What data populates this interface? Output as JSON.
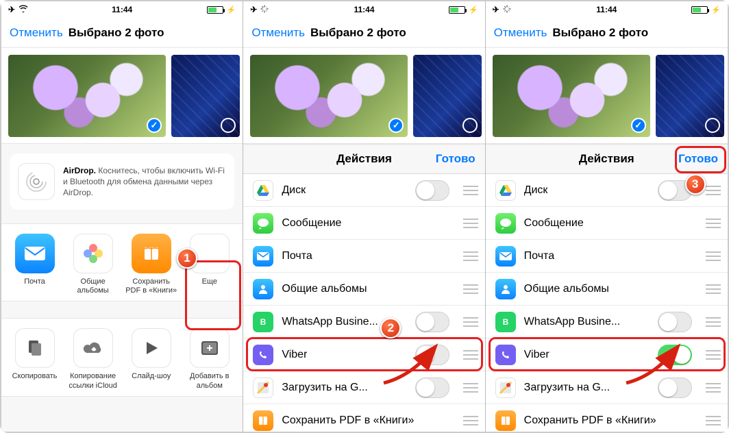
{
  "statusbar": {
    "time": "11:44"
  },
  "nav": {
    "cancel": "Отменить",
    "title": "Выбрано 2 фото"
  },
  "panel1": {
    "airdrop": {
      "title": "AirDrop.",
      "text": "Коснитесь, чтобы включить Wi-Fi и Bluetooth для обмена данными через AirDrop."
    },
    "apps": [
      {
        "label": "Почта"
      },
      {
        "label": "Общие альбомы"
      },
      {
        "label": "Сохранить PDF в «Книги»"
      },
      {
        "label": "Еще"
      }
    ],
    "actions": [
      {
        "label": "Скопировать"
      },
      {
        "label": "Копирование ссылки iCloud"
      },
      {
        "label": "Слайд-шоу"
      },
      {
        "label": "Добавить в альбом"
      }
    ]
  },
  "actionsView": {
    "title": "Действия",
    "done": "Готово",
    "items": [
      {
        "label": "Диск"
      },
      {
        "label": "Сообщение"
      },
      {
        "label": "Почта"
      },
      {
        "label": "Общие альбомы"
      },
      {
        "label": "WhatsApp Busine..."
      },
      {
        "label": "Viber"
      },
      {
        "label": "Загрузить на G..."
      },
      {
        "label": "Сохранить PDF в «Книги»"
      }
    ]
  },
  "badges": {
    "one": "1",
    "two": "2",
    "three": "3"
  }
}
